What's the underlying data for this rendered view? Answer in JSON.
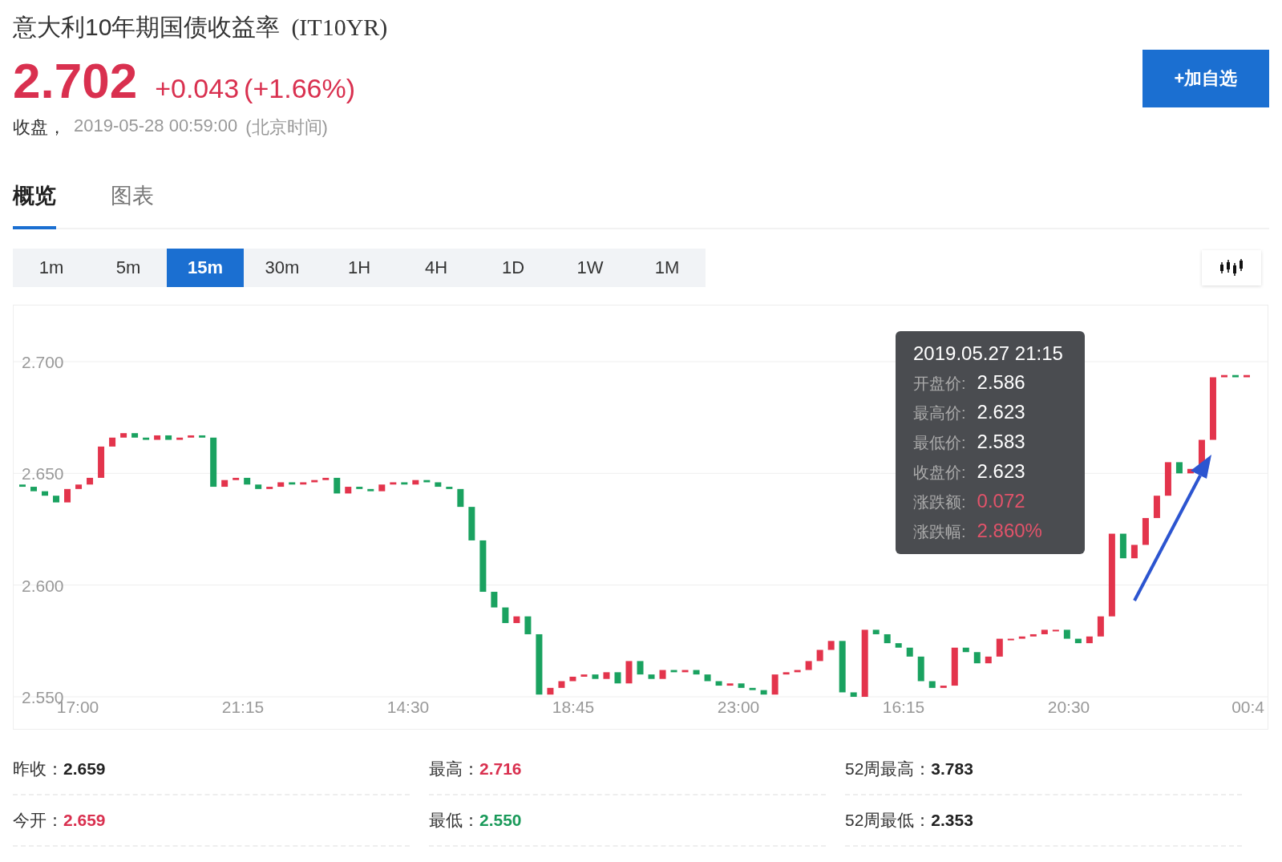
{
  "header": {
    "title": "意大利10年期国债收益率",
    "code": "(IT10YR)",
    "price": "2.702",
    "change": "+0.043",
    "change_pct": "(+1.66%)",
    "status": "收盘，",
    "datetime": "2019-05-28 00:59:00",
    "timezone": "(北京时间)",
    "watch_button": "+加自选"
  },
  "tabs": [
    {
      "label": "概览",
      "selected": true
    },
    {
      "label": "图表",
      "selected": false
    }
  ],
  "intervals": [
    {
      "label": "1m",
      "selected": false
    },
    {
      "label": "5m",
      "selected": false
    },
    {
      "label": "15m",
      "selected": true
    },
    {
      "label": "30m",
      "selected": false
    },
    {
      "label": "1H",
      "selected": false
    },
    {
      "label": "4H",
      "selected": false
    },
    {
      "label": "1D",
      "selected": false
    },
    {
      "label": "1W",
      "selected": false
    },
    {
      "label": "1M",
      "selected": false
    }
  ],
  "chart": {
    "y_labels": [
      "2.700",
      "2.650",
      "2.600",
      "2.550"
    ],
    "x_labels": [
      "17:00",
      "21:15",
      "14:30",
      "18:45",
      "23:00",
      "16:15",
      "20:30",
      "00:4"
    ],
    "tooltip": {
      "title": "2019.05.27 21:15",
      "rows": [
        {
          "label": "开盘价:",
          "value": "2.586",
          "color": "#ffffff"
        },
        {
          "label": "最高价:",
          "value": "2.623",
          "color": "#ffffff"
        },
        {
          "label": "最低价:",
          "value": "2.583",
          "color": "#ffffff"
        },
        {
          "label": "收盘价:",
          "value": "2.623",
          "color": "#ffffff"
        },
        {
          "label": "涨跌额:",
          "value": "0.072",
          "color": "#e2536a"
        },
        {
          "label": "涨跌幅:",
          "value": "2.860%",
          "color": "#e2536a"
        }
      ]
    }
  },
  "stats": [
    {
      "label": "昨收：",
      "value": "2.659",
      "color": "#222222"
    },
    {
      "label": "最高：",
      "value": "2.716",
      "color": "#d9304f"
    },
    {
      "label": "52周最高：",
      "value": "3.783",
      "color": "#222222"
    },
    {
      "label": "今开：",
      "value": "2.659",
      "color": "#d9304f"
    },
    {
      "label": "最低：",
      "value": "2.550",
      "color": "#1a9a5a"
    },
    {
      "label": "52周最低：",
      "value": "2.353",
      "color": "#222222"
    }
  ]
}
